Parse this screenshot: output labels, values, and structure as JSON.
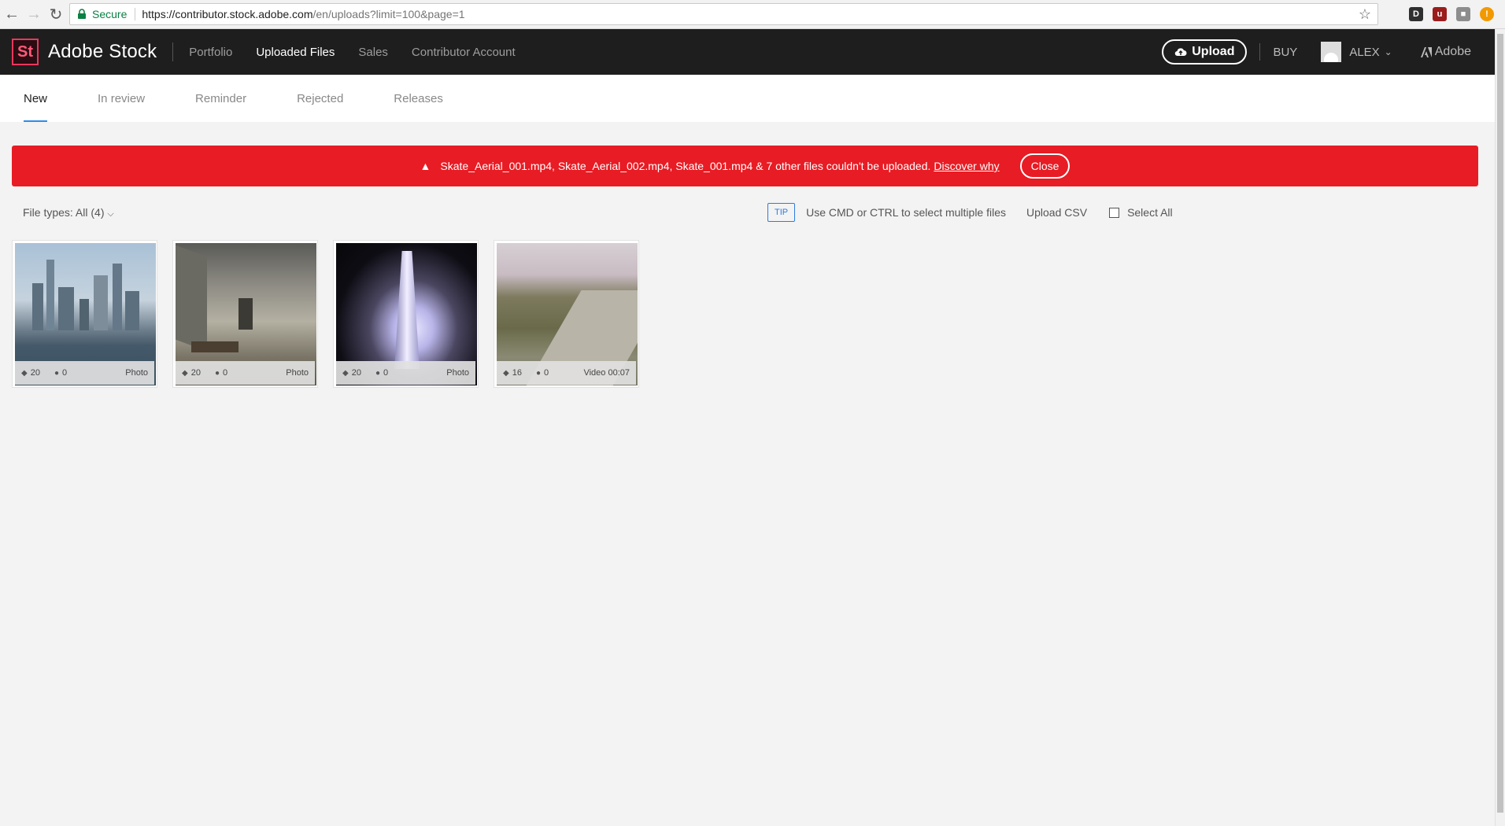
{
  "browser": {
    "secure_label": "Secure",
    "url_host": "https://contributor.stock.adobe.com",
    "url_path": "/en/uploads?limit=100&page=1"
  },
  "header": {
    "logo": "St",
    "brand": "Adobe Stock",
    "nav": [
      "Portfolio",
      "Uploaded Files",
      "Sales",
      "Contributor Account"
    ],
    "upload_label": "Upload",
    "buy_label": "BUY",
    "user_name": "ALEX",
    "adobe_label": "Adobe"
  },
  "tabs": [
    "New",
    "In review",
    "Reminder",
    "Rejected",
    "Releases"
  ],
  "alert": {
    "message": "Skate_Aerial_001.mp4, Skate_Aerial_002.mp4, Skate_001.mp4 & 7 other files couldn't be uploaded.",
    "link": "Discover why",
    "close_label": "Close",
    "color": "#e81c24"
  },
  "toolbar": {
    "file_types": "File types: All (4)",
    "tip": "TIP",
    "tip_text": "Use CMD or CTRL to select multiple files",
    "upload_csv": "Upload CSV",
    "select_all": "Select All"
  },
  "files": [
    {
      "keywords": "20",
      "people": "0",
      "type": "Photo"
    },
    {
      "keywords": "20",
      "people": "0",
      "type": "Photo"
    },
    {
      "keywords": "20",
      "people": "0",
      "type": "Photo"
    },
    {
      "keywords": "16",
      "people": "0",
      "type": "Video  00:07"
    }
  ]
}
